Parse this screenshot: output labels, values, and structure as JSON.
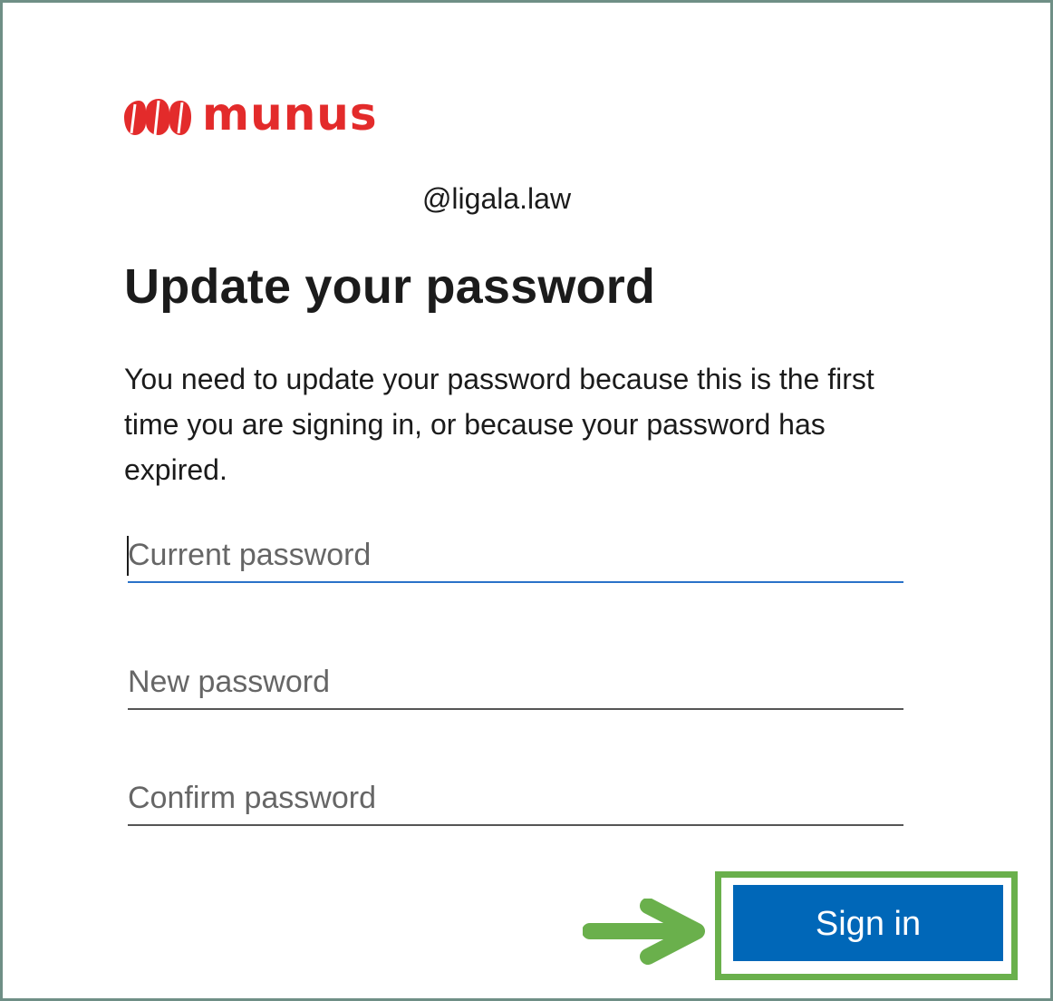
{
  "brand": {
    "name": "munus",
    "color": "#e32b2b",
    "icon": "munus-logo-icon"
  },
  "account": {
    "identity": "@ligala.law"
  },
  "page": {
    "title": "Update your password",
    "description": "You need to update your password because this is the first time you are signing in, or because your password has expired."
  },
  "form": {
    "current_password": {
      "placeholder": "Current password",
      "value": ""
    },
    "new_password": {
      "placeholder": "New password",
      "value": ""
    },
    "confirm_password": {
      "placeholder": "Confirm password",
      "value": ""
    },
    "submit_label": "Sign in"
  },
  "colors": {
    "primary_button": "#0067b8",
    "active_underline": "#2a72c8",
    "annotation": "#6ab04c",
    "frame_border": "#6f8f86"
  },
  "annotation": {
    "arrow_icon": "right-arrow-icon",
    "highlight": "sign-in-highlight"
  }
}
